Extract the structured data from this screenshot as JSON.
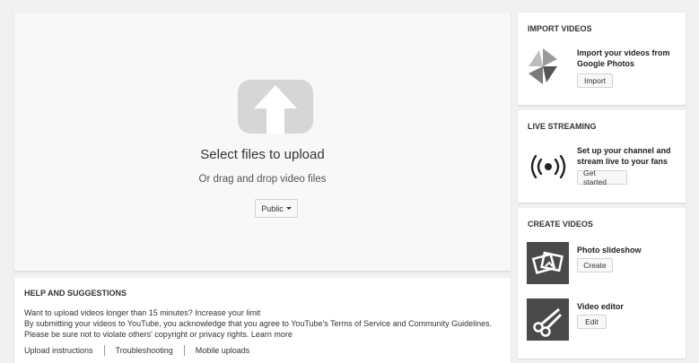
{
  "upload": {
    "title": "Select files to upload",
    "subtitle": "Or drag and drop video files",
    "privacy_value": "Public"
  },
  "help": {
    "title": "HELP AND SUGGESTIONS",
    "line1": "Want to upload videos longer than 15 minutes? Increase your limit",
    "line2": "By submitting your videos to YouTube, you acknowledge that you agree to YouTube's Terms of Service and Community Guidelines.",
    "line3": "Please be sure not to violate others' copyright or privacy rights. Learn more",
    "links": [
      "Upload instructions",
      "Troubleshooting",
      "Mobile uploads"
    ]
  },
  "sidebar": {
    "import": {
      "title": "IMPORT VIDEOS",
      "text_line1": "Import your videos from",
      "text_line2": "Google Photos",
      "button": "Import"
    },
    "live": {
      "title": "LIVE STREAMING",
      "text_line1": "Set up your channel and",
      "text_line2": "stream live to your fans",
      "button": "Get started"
    },
    "create": {
      "title": "CREATE VIDEOS",
      "items": [
        {
          "label": "Photo slideshow",
          "button": "Create"
        },
        {
          "label": "Video editor",
          "button": "Edit"
        }
      ]
    }
  },
  "icons": {
    "upload": "upload-arrow-icon",
    "pinwheel": "google-photos-pinwheel-icon",
    "live": "live-broadcast-icon",
    "slideshow": "photo-slideshow-icon",
    "editor": "scissors-icon"
  }
}
